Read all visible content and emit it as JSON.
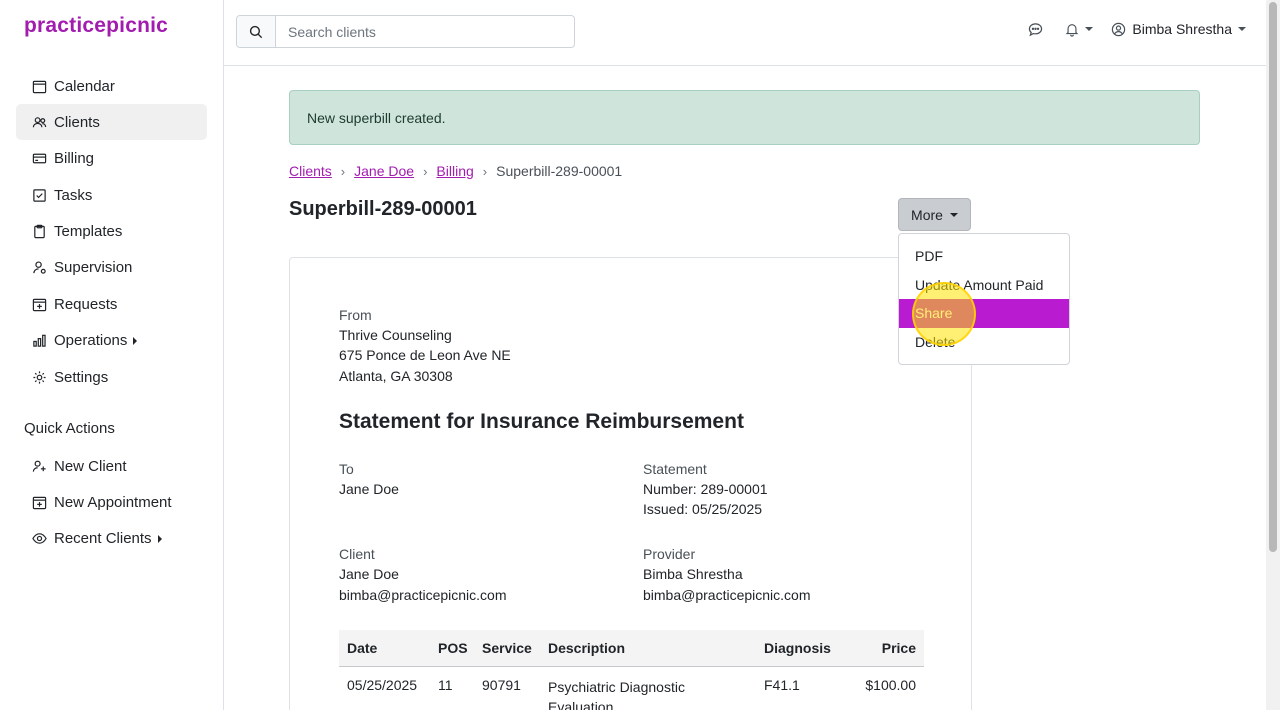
{
  "app": {
    "logo": "practicepicnic"
  },
  "sidebar": {
    "items": [
      {
        "label": "Calendar",
        "icon": "calendar-icon"
      },
      {
        "label": "Clients",
        "icon": "users-icon",
        "active": true
      },
      {
        "label": "Billing",
        "icon": "credit-card-icon"
      },
      {
        "label": "Tasks",
        "icon": "checkbox-icon"
      },
      {
        "label": "Templates",
        "icon": "clipboard-icon"
      },
      {
        "label": "Supervision",
        "icon": "supervision-icon"
      },
      {
        "label": "Requests",
        "icon": "calendar-plus-icon"
      },
      {
        "label": "Operations",
        "icon": "bar-chart-icon"
      },
      {
        "label": "Settings",
        "icon": "gear-icon"
      }
    ],
    "quick_actions_title": "Quick Actions",
    "quick_actions": [
      {
        "label": "New Client",
        "icon": "user-plus-icon"
      },
      {
        "label": "New Appointment",
        "icon": "calendar-plus-icon"
      },
      {
        "label": "Recent Clients",
        "icon": "eye-icon"
      }
    ]
  },
  "topbar": {
    "search_placeholder": "Search clients",
    "user_name": "Bimba Shrestha"
  },
  "alert": {
    "message": "New superbill created."
  },
  "breadcrumb": {
    "links": [
      "Clients",
      "Jane Doe",
      "Billing"
    ],
    "current": "Superbill-289-00001",
    "separator": "›"
  },
  "page": {
    "title": "Superbill-289-00001"
  },
  "more_menu": {
    "button_label": "More",
    "items": [
      "PDF",
      "Update Amount Paid",
      "Share",
      "Delete"
    ],
    "highlighted": "Share"
  },
  "superbill": {
    "from_label": "From",
    "from_name": "Thrive Counseling",
    "from_address1": "675 Ponce de Leon Ave NE",
    "from_address2": "Atlanta, GA 30308",
    "title": "Statement for Insurance Reimbursement",
    "to_label": "To",
    "to_name": "Jane Doe",
    "statement_label": "Statement",
    "statement_number": "Number: 289-00001",
    "statement_issued": "Issued: 05/25/2025",
    "client_label": "Client",
    "client_name": "Jane Doe",
    "client_email": "bimba@practicepicnic.com",
    "provider_label": "Provider",
    "provider_name": "Bimba Shrestha",
    "provider_email": "bimba@practicepicnic.com",
    "table": {
      "headers": [
        "Date",
        "POS",
        "Service",
        "Description",
        "Diagnosis",
        "Price"
      ],
      "rows": [
        {
          "date": "05/25/2025",
          "pos": "11",
          "service": "90791",
          "description": "Psychiatric Diagnostic Evaluation",
          "diagnosis": "F41.1",
          "price": "$100.00"
        }
      ]
    }
  },
  "colors": {
    "brand": "#a21caf",
    "menu_highlight": "#b91bd0",
    "alert_bg": "#cfe5dc"
  }
}
